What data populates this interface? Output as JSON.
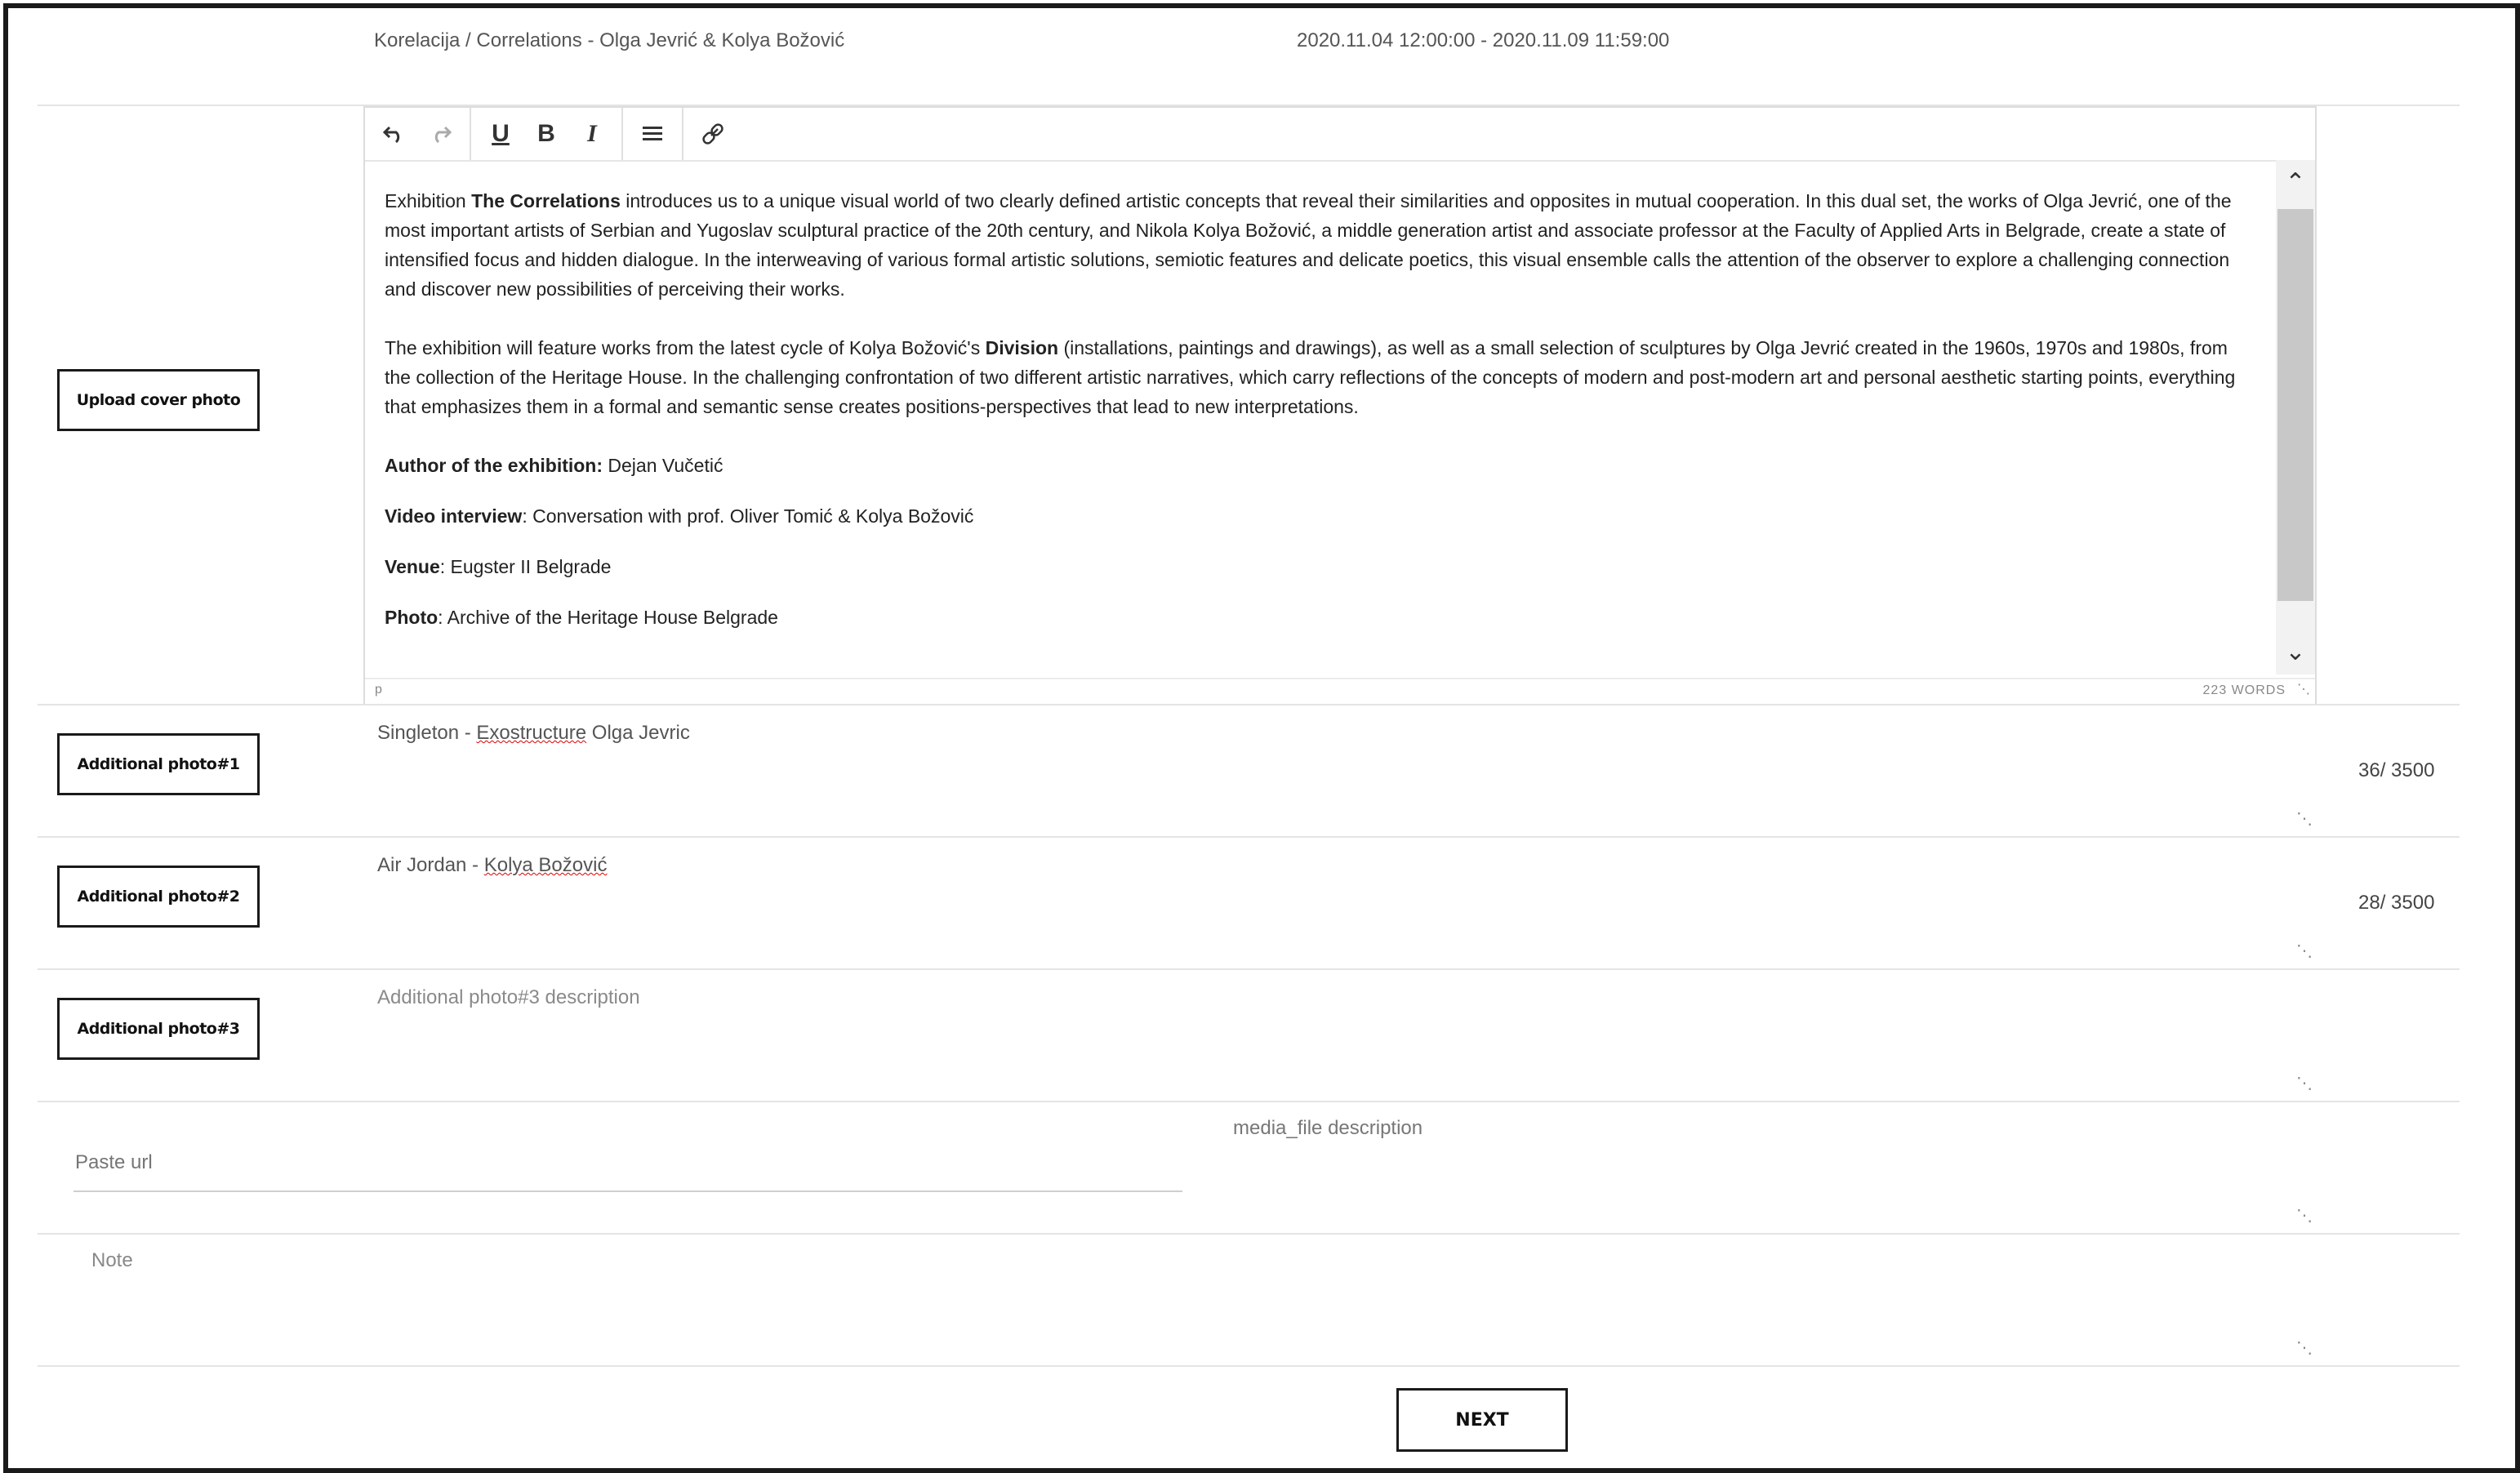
{
  "header": {
    "title": "Korelacija / Correlations - Olga Jevrić & Kolya Božović",
    "dates": "2020.11.04 12:00:00 - 2020.11.09 11:59:00"
  },
  "toolbar": {
    "undo_icon": "undo-icon",
    "redo_icon": "redo-icon",
    "underline": "U",
    "bold": "B",
    "italic": "I",
    "align_icon": "align-icon",
    "link_icon": "link-icon"
  },
  "editor": {
    "p1_pre": "Exhibition ",
    "p1_bold": "The Correlations",
    "p1_post": " introduces us to a unique visual world of two clearly defined artistic concepts that reveal their similarities and opposites in mutual cooperation. In this dual set, the works of Olga Jevrić, one of the most important artists of Serbian and Yugoslav sculptural practice of the 20th century, and Nikola Kolya Božović, a middle generation artist and associate professor at the Faculty of Applied Arts in Belgrade, create a state of intensified focus and hidden dialogue. In the interweaving of various formal artistic solutions, semiotic features and delicate poetics, this visual ensemble calls the attention of the observer to explore a challenging connection and discover new possibilities of perceiving their works.",
    "p2_pre": "The exhibition will feature works from the latest cycle of Kolya Božović's ",
    "p2_bold": "Division",
    "p2_post": " (installations, paintings and drawings), as well as a small selection of sculptures by Olga Jevrić created in the 1960s, 1970s and 1980s, from the collection of the Heritage House. In the challenging confrontation of two different artistic narratives, which carry reflections of the concepts of modern and post-modern art and personal aesthetic starting points, everything that emphasizes them in a formal and semantic sense creates positions-perspectives that lead to new interpretations.",
    "author_label": "Author of the exhibition:",
    "author_value": " Dejan Vučetić",
    "video_label": "Video interview",
    "video_value": ": Conversation with prof. Oliver Tomić & Kolya Božović",
    "venue_label": "Venue",
    "venue_value": ": Eugster II Belgrade",
    "photo_label": "Photo",
    "photo_value": ": Archive of the Heritage House Belgrade",
    "status_path": "p",
    "word_count": "223 WORDS"
  },
  "buttons": {
    "cover": "Upload cover photo",
    "photo1": "Additional photo#1",
    "photo2": "Additional photo#2",
    "photo3": "Additional photo#3",
    "next": "NEXT"
  },
  "photo1": {
    "text_pre": "Singleton - ",
    "text_spell": "Exostructure",
    "text_post": " Olga Jevric",
    "counter": "36/ 3500"
  },
  "photo2": {
    "text_pre": "Air Jordan - ",
    "text_spell": "Kolya Božović",
    "counter": "28/ 3500"
  },
  "photo3": {
    "placeholder": "Additional photo#3 description"
  },
  "media": {
    "url_placeholder": "Paste url",
    "description_placeholder": "media_file description"
  },
  "note": {
    "placeholder": "Note"
  }
}
